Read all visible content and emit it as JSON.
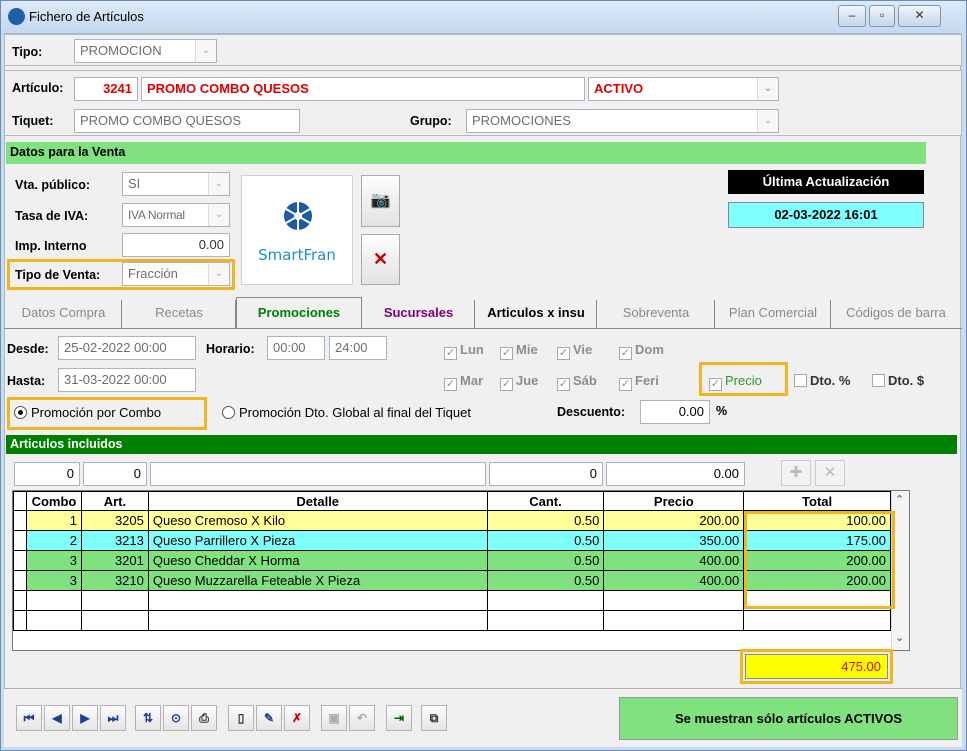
{
  "window": {
    "title": "Fichero de Artículos"
  },
  "tipo": {
    "label": "Tipo:",
    "value": "PROMOCION"
  },
  "articulo": {
    "label": "Artículo:",
    "code": "3241",
    "name": "PROMO COMBO QUESOS",
    "estado": "ACTIVO"
  },
  "tiquet": {
    "label": "Tiquet:",
    "value": "PROMO COMBO QUESOS"
  },
  "grupo": {
    "label": "Grupo:",
    "value": "PROMOCIONES"
  },
  "venta": {
    "header": "Datos para la Venta",
    "vta_publico_label": "Vta. público:",
    "vta_publico_value": "SI",
    "tasa_iva_label": "Tasa de IVA:",
    "tasa_iva_value": "IVA Normal",
    "imp_interno_label": "Imp. Interno",
    "imp_interno_value": "0.00",
    "tipo_venta_label": "Tipo de Venta:",
    "tipo_venta_value": "Fracción"
  },
  "logo": {
    "text": "SmartFran"
  },
  "ultima": {
    "label": "Última Actualización",
    "value": "02-03-2022 16:01"
  },
  "tabs": [
    "Datos Compra",
    "Recetas",
    "Promociones",
    "Sucursales",
    "Articulos x insu",
    "Sobreventa",
    "Plan Comercial",
    "Códigos de barra"
  ],
  "promo": {
    "desde_label": "Desde:",
    "desde_value": "25-02-2022 00:00",
    "hasta_label": "Hasta:",
    "hasta_value": "31-03-2022 00:00",
    "horario_label": "Horario:",
    "horario_from": "00:00",
    "horario_to": "24:00",
    "days_row1": [
      "Lun",
      "Mie",
      "Vie",
      "Dom"
    ],
    "days_row2": [
      "Mar",
      "Jue",
      "Sáb",
      "Feri"
    ],
    "precio_label": "Precio",
    "dto_pct_label": "Dto. %",
    "dto_amt_label": "Dto. $",
    "radio_combo": "Promoción por Combo",
    "radio_global": "Promoción Dto. Global al final del Tiquet",
    "descuento_label": "Descuento:",
    "descuento_value": "0.00",
    "descuento_unit": "%"
  },
  "incluidos": {
    "header": "Articulos incluidos",
    "input_combo": "0",
    "input_art": "0",
    "input_detalle": "",
    "input_cant": "0",
    "input_precio": "0.00",
    "columns": [
      "Combo",
      "Art.",
      "Detalle",
      "Cant.",
      "Precio",
      "Total"
    ],
    "rows": [
      {
        "combo": "1",
        "art": "3205",
        "detalle": "Queso Cremoso X Kilo",
        "cant": "0.50",
        "precio": "200.00",
        "total": "100.00",
        "color": "#ffff99"
      },
      {
        "combo": "2",
        "art": "3213",
        "detalle": "Queso Parrillero X Pieza",
        "cant": "0.50",
        "precio": "350.00",
        "total": "175.00",
        "color": "#80ffff"
      },
      {
        "combo": "3",
        "art": "3201",
        "detalle": "Queso Cheddar X Horma",
        "cant": "0.50",
        "precio": "400.00",
        "total": "200.00",
        "color": "#7fe27f"
      },
      {
        "combo": "3",
        "art": "3210",
        "detalle": "Queso Muzzarella Feteable X Pieza",
        "cant": "0.50",
        "precio": "400.00",
        "total": "200.00",
        "color": "#7fe27f"
      }
    ],
    "grand_total": "475.00"
  },
  "status": {
    "activos": "Se muestran sólo artículos ACTIVOS"
  },
  "colors": {
    "accent_green": "#7fe27f",
    "dark_green": "#008000",
    "highlight": "#f2b51f",
    "cyan": "#80ffff",
    "yellow": "#ffff99",
    "red": "#e00000"
  }
}
